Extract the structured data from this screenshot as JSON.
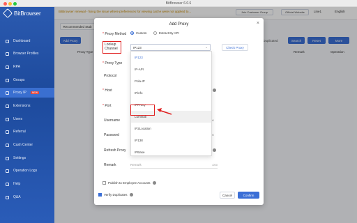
{
  "window": {
    "title": "BitBrowser 6.0.6"
  },
  "header": {
    "warning": "BitBrowser renewal - fixing the issue where preferences for viewing cache were not applied to...",
    "join_group": "Join Customer Group",
    "official_website": "Official Website",
    "user": "Line1",
    "language": "English"
  },
  "sidebar": {
    "brand": "BitBrowser",
    "items": [
      {
        "label": "Dashboard"
      },
      {
        "label": "Browser Profiles"
      },
      {
        "label": "RPA"
      },
      {
        "label": "Groups"
      },
      {
        "label": "Proxy IP",
        "badge": "NEW"
      },
      {
        "label": "Extensions"
      },
      {
        "label": "Users"
      },
      {
        "label": "Referral"
      },
      {
        "label": "Cash Center"
      },
      {
        "label": "Settings"
      },
      {
        "label": "Operation Logs"
      },
      {
        "label": "Help"
      },
      {
        "label": "Q&A"
      }
    ]
  },
  "toolbar": {
    "recommended": "Recommended Stab",
    "add_proxy": "Add Proxy",
    "filter_duplicated": "er Duplicated",
    "search": "Search",
    "reset": "Reset",
    "more": "More"
  },
  "table": {
    "columns": [
      "Proxy Type",
      "Remark",
      "Operation"
    ]
  },
  "modal": {
    "title": "Add Proxy",
    "proxy_method_label": "Proxy Method",
    "method_custom": "Custom",
    "method_api": "Extract By API",
    "lookup_channel_label": "Lookup Channel",
    "lookup_channel_value": "IP123",
    "check_proxy": "Check Proxy",
    "proxy_type_label": "Proxy Type",
    "protocol_label": "Protocol",
    "host_label": "Host",
    "port_label": "Port",
    "username_label": "Username",
    "password_label": "Password",
    "refresh_proxy_label": "Refresh Proxy",
    "remark_label": "Remark",
    "remark_placeholder": "Remark",
    "counter_200": "/200",
    "counter_200b": "200",
    "publish_label": "Publish to Employee Accounts",
    "verify_label": "Verify Duplicates",
    "cancel": "Cancel",
    "confirm": "Confirm",
    "options": [
      "IP123",
      "IP-API",
      "Pola-IP",
      "IPinfo",
      "IPProxy",
      "Luminati",
      "IP2Location",
      "IP138",
      "IPBase"
    ]
  },
  "colors": {
    "accent": "#3b6fd6",
    "highlight": "#e02020",
    "sidebar": "#2b5ab0"
  }
}
